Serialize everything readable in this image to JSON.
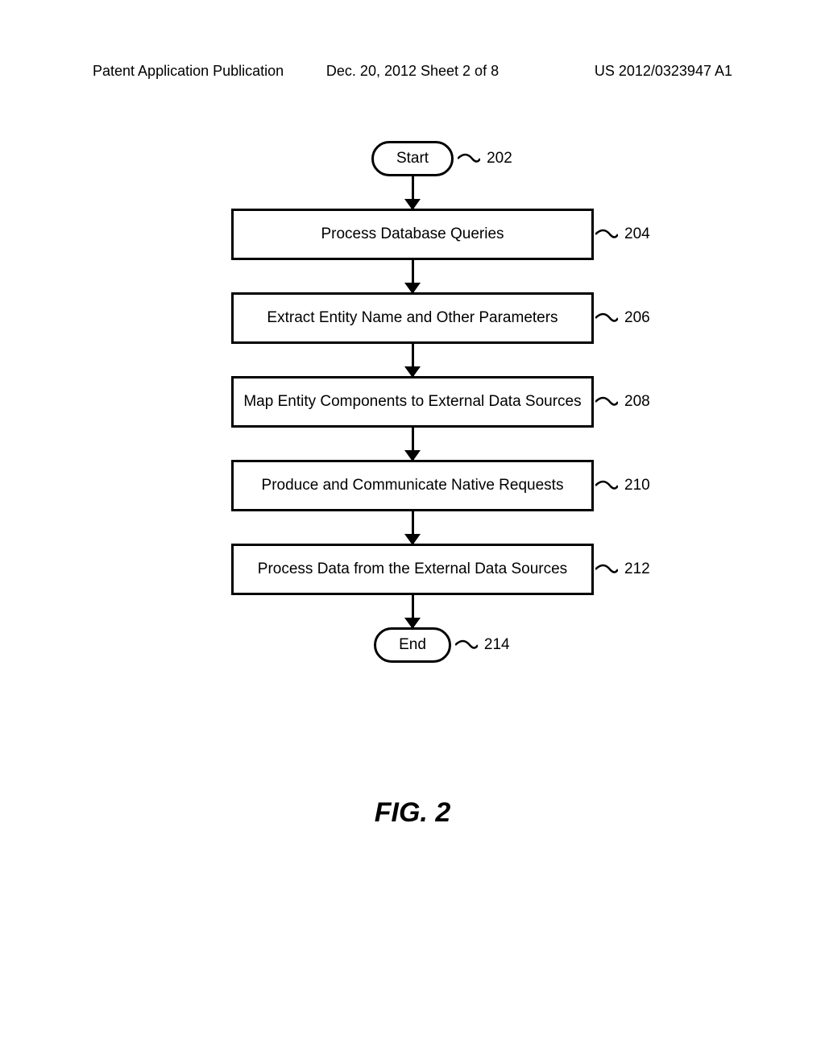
{
  "header": {
    "left": "Patent Application Publication",
    "center": "Dec. 20, 2012  Sheet 2 of 8",
    "right": "US 2012/0323947 A1"
  },
  "flowchart": {
    "start": {
      "text": "Start",
      "label": "202"
    },
    "steps": [
      {
        "text": "Process Database Queries",
        "label": "204"
      },
      {
        "text": "Extract Entity Name and Other Parameters",
        "label": "206"
      },
      {
        "text": "Map Entity Components to External Data Sources",
        "label": "208"
      },
      {
        "text": "Produce and Communicate Native Requests",
        "label": "210"
      },
      {
        "text": "Process Data from the External Data Sources",
        "label": "212"
      }
    ],
    "end": {
      "text": "End",
      "label": "214"
    }
  },
  "figure": "FIG. 2"
}
